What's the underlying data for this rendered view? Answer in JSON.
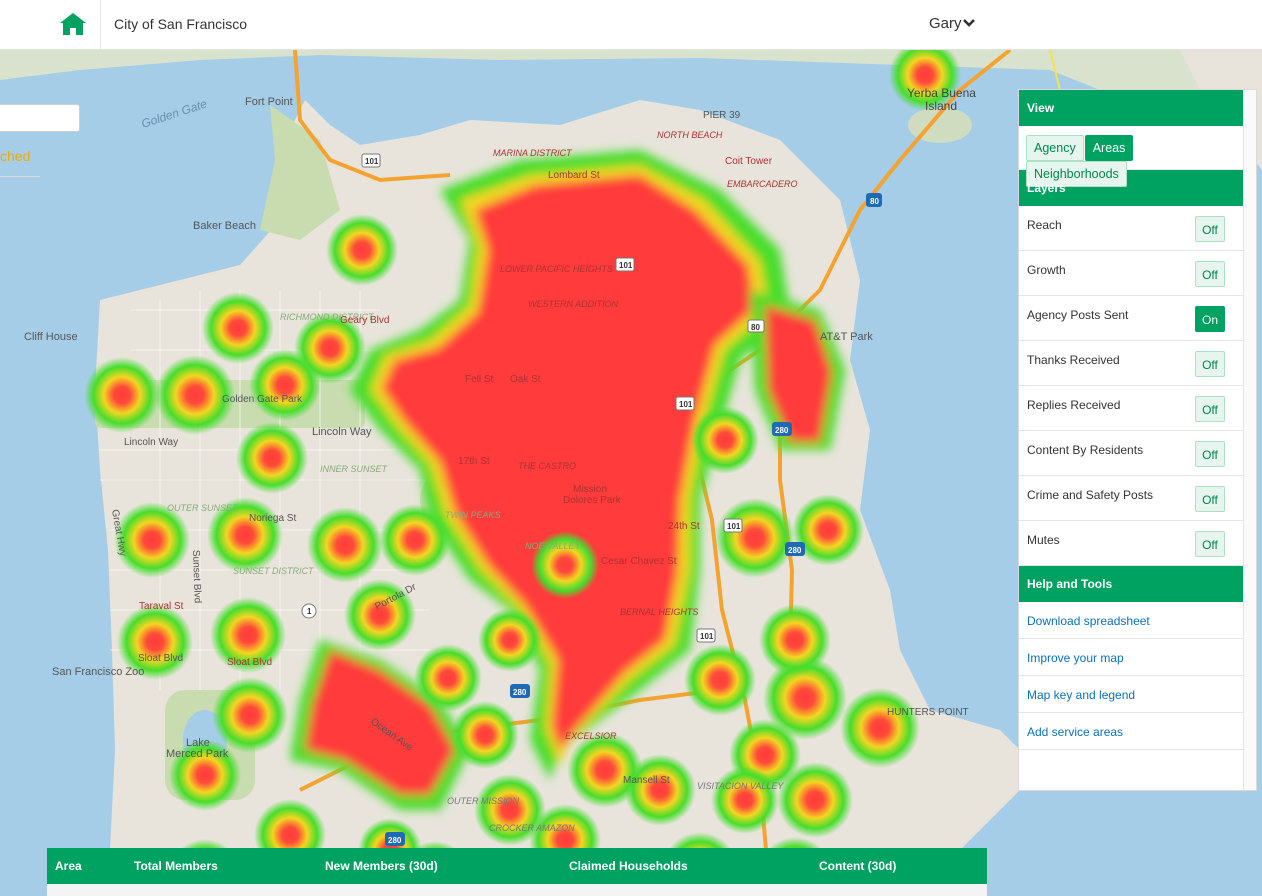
{
  "header": {
    "home_icon": "home-icon",
    "title": "City of San Francisco",
    "user": "Gary",
    "user_menu_icon": "chevron-down-icon"
  },
  "left_partial": {
    "tab_text": "ched"
  },
  "map": {
    "labels": {
      "fort_point": "Fort Point",
      "golden_gate": "Golden Gate",
      "yerba_buena": "Yerba Buena",
      "island": "Island",
      "pier39": "PIER 39",
      "baker_beach": "Baker Beach",
      "cliff_house": "Cliff House",
      "att_park": "AT&T Park",
      "sf_zoo": "San Francisco Zoo",
      "lake": "Lake",
      "merced_park": "Merced Park",
      "hunters_point": "HUNTERS POINT",
      "golden_gate_park": "Golden Gate Park",
      "lincoln_way": "Lincoln Way",
      "mission": "Mission",
      "dolores_park": "Dolores Park",
      "the_castro": "THE CASTRO",
      "twin_peaks": "TWIN PEAKS",
      "noe_valley": "NOE VALLEY",
      "bernal_heights": "BERNAL HEIGHTS",
      "excelsior": "EXCELSIOR",
      "outer_mission": "OUTER MISSION",
      "crocker_amazon": "CROCKER AMAZON",
      "visitacion_valley": "VISITACION VALLEY",
      "marina_district": "MARINA DISTRICT",
      "lower_pacific_heights": "LOWER PACIFIC HEIGHTS",
      "western_addition": "WESTERN ADDITION",
      "inner_sunset": "INNER SUNSET",
      "outer_sunset": "OUTER SUNSET",
      "sunset_district": "SUNSET DISTRICT",
      "richmond_district": "RICHMOND DISTRICT",
      "north_beach": "NORTH BEACH",
      "embarcadero": "EMBARCADERO",
      "coit_tower": "Coit Tower",
      "lombard_st": "Lombard St",
      "geary_blvd": "Geary Blvd",
      "fell_st": "Fell St",
      "oak_st": "Oak St",
      "17th_st": "17th St",
      "24th_st": "24th St",
      "cesar_chavez": "Cesar Chavez St",
      "noriega_st": "Noriega St",
      "taraval_st": "Taraval St",
      "sloat_blvd": "Sloat Blvd",
      "ocean_ave": "Ocean Ave",
      "mansell_st": "Mansell St",
      "portola_dr": "Portola Dr",
      "great_hwy": "Great Hwy",
      "sunset_blvd": "Sunset Blvd",
      "rt101": "101",
      "rt280": "280",
      "rt80": "80",
      "rt1": "1"
    }
  },
  "panel": {
    "view_title": "View",
    "view_buttons": [
      {
        "label": "Agency",
        "active": false
      },
      {
        "label": "Areas",
        "active": true
      },
      {
        "label": "Neighborhoods",
        "active": false
      }
    ],
    "layers_title": "Layers",
    "layers": [
      {
        "label": "Reach",
        "state": "Off"
      },
      {
        "label": "Growth",
        "state": "Off"
      },
      {
        "label": "Agency Posts Sent",
        "state": "On"
      },
      {
        "label": "Thanks Received",
        "state": "Off"
      },
      {
        "label": "Replies Received",
        "state": "Off"
      },
      {
        "label": "Content By Residents",
        "state": "Off"
      },
      {
        "label": "Crime and Safety Posts",
        "state": "Off"
      },
      {
        "label": "Mutes",
        "state": "Off"
      }
    ],
    "help_title": "Help and Tools",
    "help_links": [
      "Download spreadsheet",
      "Improve your map",
      "Map key and legend",
      "Add service areas"
    ]
  },
  "table": {
    "columns": [
      "Area",
      "Total Members",
      "New Members (30d)",
      "Claimed Households",
      "Content (30d)"
    ]
  },
  "colors": {
    "accent": "#00a261",
    "heat_hot": "#ff3b3b",
    "heat_mid": "#f0e020",
    "heat_cool": "#3ddc2a",
    "water": "#a5cde8",
    "land": "#e8e4dc"
  }
}
